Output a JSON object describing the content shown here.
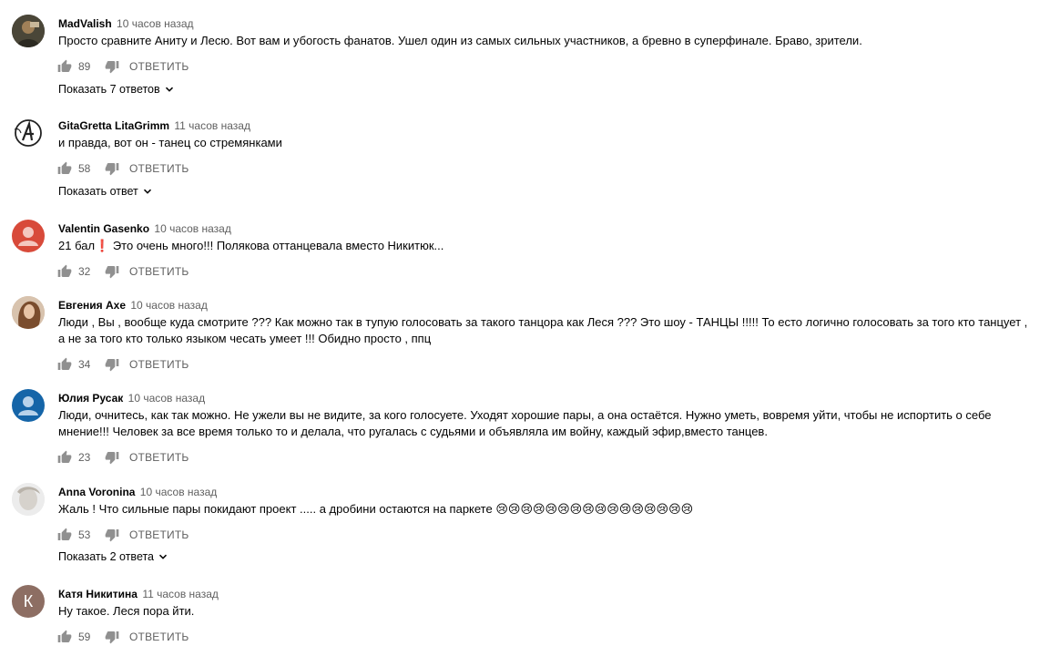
{
  "comments": [
    {
      "author": "MadValish",
      "time": "10 часов назад",
      "text": "Просто сравните Аниту и Лесю. Вот вам и убогость фанатов. Ушел один из самых сильных участников, а бревно в суперфинале. Браво, зрители.",
      "likes": "89",
      "reply_label": "ОТВЕТИТЬ",
      "show_replies": "Показать 7 ответов",
      "avatar_icon": "person-photo-icon"
    },
    {
      "author": "GitaGretta LitaGrimm",
      "time": "11 часов назад",
      "text": "и правда, вот он - танец со стремянками",
      "likes": "58",
      "reply_label": "ОТВЕТИТЬ",
      "show_replies": "Показать ответ",
      "avatar_icon": "logo-avatar-icon"
    },
    {
      "author": "Valentin Gasenko",
      "time": "10 часов назад",
      "text": "21 бал❗ Это очень много!!! Полякова оттанцевала вместо Никитюк...",
      "likes": "32",
      "reply_label": "ОТВЕТИТЬ",
      "avatar_icon": "default-user-icon"
    },
    {
      "author": "Евгения Axe",
      "time": "10 часов назад",
      "text": "Люди , Вы , вообще куда смотрите ??? Как можно так в тупую голосовать за такого танцора как Леся ??? Это шоу - ТАНЦЫ !!!!! То есто логично голосовать за того кто танцует , а не за того кто только языком чесать умеет !!! Обидно просто , ппц",
      "likes": "34",
      "reply_label": "ОТВЕТИТЬ",
      "avatar_icon": "person-photo-icon"
    },
    {
      "author": "Юлия Русак",
      "time": "10 часов назад",
      "text": "Люди, очнитесь, как так можно. Не ужели вы не видите, за кого голосуете. Уходят хорошие пары, а она остаётся. Нужно уметь, вовремя уйти, чтобы не испортить о себе мнение!!! Человек за все время только то и делала, что ругалась с судьями и объявляла им войну, каждый эфир,вместо танцев.",
      "likes": "23",
      "reply_label": "ОТВЕТИТЬ",
      "avatar_icon": "default-user-icon"
    },
    {
      "author": "Anna Voronina",
      "time": "10 часов назад",
      "text": "Жаль ! Что сильные пары покидают проект ..... а дробини остаются на паркете 😢😢😢😢😢😢😢😢😢😢😢😢😢😢😢😢",
      "likes": "53",
      "reply_label": "ОТВЕТИТЬ",
      "show_replies": "Показать 2 ответа",
      "avatar_icon": "person-photo-icon"
    },
    {
      "author": "Катя Никитина",
      "time": "11 часов назад",
      "text": "Ну такое. Леся пора йти.",
      "likes": "59",
      "reply_label": "ОТВЕТИТЬ",
      "avatar_letter": "К",
      "avatar_icon": "letter-avatar-icon"
    }
  ],
  "colors": {
    "meta": "#606060",
    "text": "#030303",
    "avatar_red": "#d84a3a",
    "avatar_blue": "#1565a8",
    "avatar_brown": "#8d6e63"
  }
}
